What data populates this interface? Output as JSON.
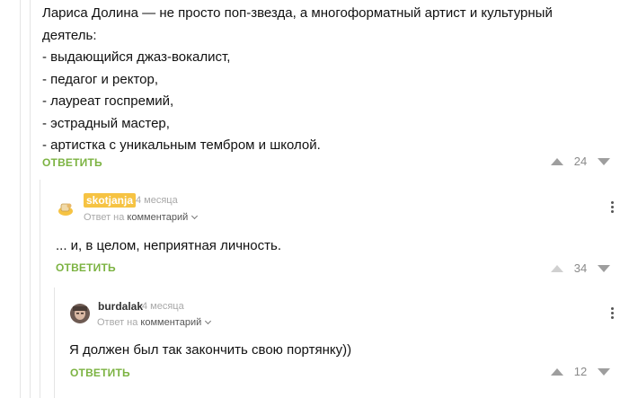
{
  "comment1": {
    "lines": [
      "Лариса Долина — не просто поп-звезда, а многоформатный артист и культурный",
      "деятель:",
      "- выдающийся джаз-вокалист,",
      "- педагог и ректор,",
      "- лауреат госпремий,",
      "- эстрадный мастер,",
      "- артистка с уникальным тембром и школой."
    ],
    "reply_label": "ОТВЕТИТЬ",
    "rating": "24"
  },
  "comment2": {
    "username": "skotjanja",
    "time": "4 месяца",
    "reply_prefix": "Ответ на",
    "reply_target": "комментарий",
    "text": "... и, в целом, неприятная личность.",
    "reply_label": "ОТВЕТИТЬ",
    "rating": "34"
  },
  "comment3": {
    "username": "burdalak",
    "time": "4 месяца",
    "reply_prefix": "Ответ на",
    "reply_target": "комментарий",
    "text": "Я должен был так закончить свою портянку))",
    "reply_label": "ОТВЕТИТЬ",
    "rating": "12"
  },
  "colors": {
    "accent_green": "#7cb342",
    "badge_yellow": "#f6c343"
  }
}
